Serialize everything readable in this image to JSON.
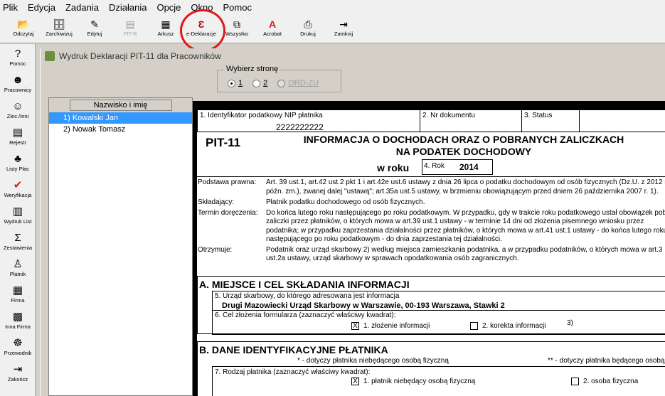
{
  "menu": [
    "Plik",
    "Edycja",
    "Zadania",
    "Działania",
    "Opcje",
    "Okno",
    "Pomoc"
  ],
  "toolbar": [
    {
      "label": "Odczytaj",
      "icon": "folder-open-icon",
      "glyph": "📂",
      "enabled": true
    },
    {
      "label": "Zarchiwizuj",
      "icon": "archive-icon",
      "glyph": "🗄",
      "enabled": true
    },
    {
      "label": "Edytuj",
      "icon": "edit-icon",
      "glyph": "✎",
      "enabled": true
    },
    {
      "label": "PIT-R",
      "icon": "pitr-icon",
      "glyph": "▤",
      "enabled": false
    },
    {
      "label": "Arkusz",
      "icon": "sheet-icon",
      "glyph": "▦",
      "enabled": true
    },
    {
      "label": "e-Deklaracje",
      "icon": "e-declaration-icon",
      "glyph": "Ɛ",
      "enabled": true
    },
    {
      "label": "Wszystko",
      "icon": "all-icon",
      "glyph": "⧉",
      "enabled": true
    },
    {
      "label": "Acrobat",
      "icon": "acrobat-icon",
      "glyph": "A",
      "enabled": true
    },
    {
      "label": "Drukuj",
      "icon": "printer-icon",
      "glyph": "⎙",
      "enabled": true
    },
    {
      "label": "Zamknij",
      "icon": "exit-icon",
      "glyph": "⇥",
      "enabled": true
    }
  ],
  "sidebar": [
    {
      "label": "Pomoc",
      "icon": "help-icon",
      "glyph": "?"
    },
    {
      "label": "Pracownicy",
      "icon": "employees-icon",
      "glyph": "☻"
    },
    {
      "label": "Zlec./Inni",
      "icon": "contractors-icon",
      "glyph": "☺"
    },
    {
      "label": "Rejestr",
      "icon": "register-icon",
      "glyph": "▤"
    },
    {
      "label": "Listy Płac",
      "icon": "payroll-icon",
      "glyph": "♣"
    },
    {
      "label": "Weryfikacja",
      "icon": "check-icon",
      "glyph": "✔"
    },
    {
      "label": "Wydruk List",
      "icon": "print-list-icon",
      "glyph": "▥"
    },
    {
      "label": "Zestawienia",
      "icon": "sigma-icon",
      "glyph": "Σ"
    },
    {
      "label": "Płatnik",
      "icon": "payer-icon",
      "glyph": "♙"
    },
    {
      "label": "Firma",
      "icon": "company-icon",
      "glyph": "▦"
    },
    {
      "label": "Inna Firma",
      "icon": "other-company-icon",
      "glyph": "▩"
    },
    {
      "label": "Przewodnik",
      "icon": "guide-icon",
      "glyph": "☸"
    },
    {
      "label": "Zakończ",
      "icon": "exit-icon",
      "glyph": "⇥"
    }
  ],
  "window": {
    "title": "Wydruk Deklaracji PIT-11 dla Pracowników"
  },
  "page_select": {
    "title": "Wybierz stronę",
    "options": [
      {
        "label": "1",
        "selected": true,
        "enabled": true
      },
      {
        "label": "2",
        "selected": false,
        "enabled": true
      },
      {
        "label": "ORD-ZU",
        "selected": false,
        "enabled": false
      }
    ]
  },
  "employees": {
    "header": "Nazwisko i imię",
    "rows": [
      {
        "label": "1) Kowalski Jan",
        "selected": true
      },
      {
        "label": "2) Nowak Tomasz",
        "selected": false
      }
    ]
  },
  "form": {
    "nip_label": "1. Identyfikator podatkowy NIP płatnika",
    "nip_value": "2222222222",
    "doc_no_label": "2. Nr dokumentu",
    "status_label": "3. Status",
    "form_code": "PIT-11",
    "heading_line1": "INFORMACJA O DOCHODACH ORAZ O POBRANYCH ZALICZKACH",
    "heading_line2": "NA PODATEK DOCHODOWY",
    "year_prefix": "w roku",
    "year_label": "4. Rok",
    "year_value": "2014",
    "legal_basis_label": "Podstawa prawna:",
    "legal_basis_text": "Art. 39 ust.1, art.42 ust.2 pkt 1 i art.42e ust.6 ustawy z dnia 26 lipca o podatku dochodowym od osób fizycznych (Dz.U. z 2012 r. późn. zm.), zwanej dalej \"ustawą\"; art.35a ust.5 ustawy, w brzmieniu obowiązującym przed dniem 26 października 2007 r. 1).",
    "submitter_label": "Składający:",
    "submitter_text": "Płatnik podatku dochodowego od osób fizycznych.",
    "deadline_label": "Termin doręczenia:",
    "deadline_text": "Do końca lutego roku następującego po roku podatkowym. W przypadku, gdy w trakcie roku podatkowego ustał obowiązek poboru zaliczki przez płatników, o których mowa w art.39 ust.1 ustawy - w terminie 14 dni od złożenia pisemnego wniosku przez podatnika; w przypadku zaprzestania działalności przez płatników, o których mowa w art.41 ust.1 ustawy - do końca lutego roku następującego po roku podatkowym - do dnia zaprzestania tej działalności.",
    "recipient_label": "Otrzymuje:",
    "recipient_text": "Podatnik oraz urząd skarbowy 2) według miejsca zamieszkania podatnika, a w przypadku podatników, o których mowa w art.3 ust.2a ustawy, urząd skarbowy w sprawach opodatkowania osób zagranicznych.",
    "section_a_title": "A. MIEJSCE I CEL SKŁADANIA INFORMACJI",
    "tax_office_label": "5. Urząd skarbowy, do którego adresowana jest informacja",
    "tax_office_value": "Drugi Mazowiecki Urząd Skarbowy w Warszawie, 00-193 Warszawa, Stawki 2",
    "purpose_label": "6. Cel złożenia formularza (zaznaczyć właściwy kwadrat):",
    "purpose_opt1": "1. złożenie informacji",
    "purpose_opt1_mark": "X",
    "purpose_opt2": "2. korekta informacji",
    "purpose_note": "3)",
    "section_b_title": "B. DANE IDENTYFIKACYJNE PŁATNIKA",
    "b_note1": "* - dotyczy płatnika niebędącego osobą fizyczną",
    "b_note2": "** - dotyczy płatnika będącego osobą fizyczną",
    "payer_type_label": "7. Rodzaj płatnika (zaznaczyć właściwy kwadrat):",
    "payer_type_opt1": "1. płatnik niebędący osobą fizyczną",
    "payer_type_opt1_mark": "X",
    "payer_type_opt2": "2. osoba fizyczna"
  }
}
